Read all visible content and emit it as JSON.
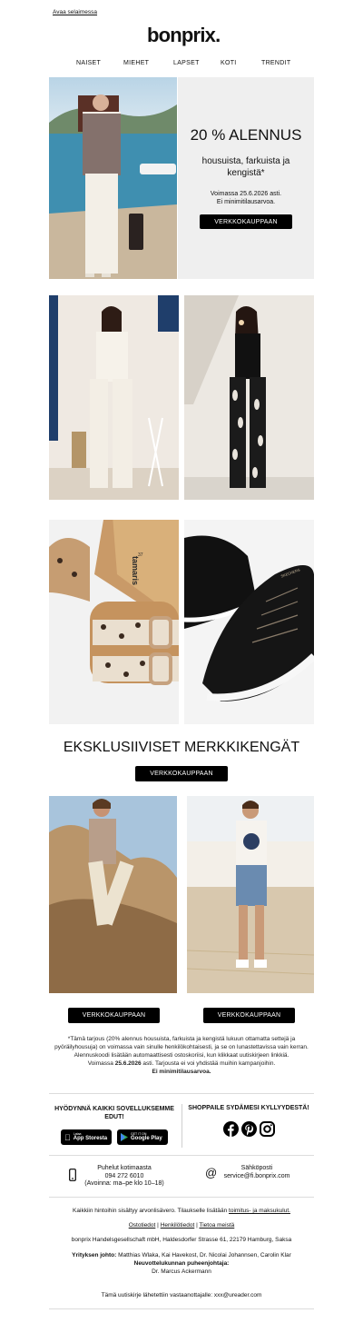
{
  "topbar": {
    "open_in_browser": "Avaa selaimessa"
  },
  "brand": {
    "logo": "bonprix."
  },
  "nav": {
    "items": [
      "NAISET",
      "MIEHET",
      "LAPSET",
      "KOTI",
      "TRENDIT"
    ]
  },
  "hero": {
    "headline": "20 % ALENNUS",
    "subline": "housuista, farkuista ja kengistä*",
    "valid_line": "Voimassa 25.6.2026 asti.",
    "min_line": "Ei minimitilausarvoa.",
    "cta": "VERKKOKAUPPAAN"
  },
  "section_shoes": {
    "title": "EKSKLUSIIVISET MERKKIKENGÄT",
    "cta": "VERKKOKAUPPAAN"
  },
  "products": {
    "shoe_brand": "tamaris",
    "shoe_size": "37",
    "sneaker_brand": "SKECHERS"
  },
  "men_kids": {
    "cta_left": "VERKKOKAUPPAAN",
    "cta_right": "VERKKOKAUPPAAN"
  },
  "disclaimer": {
    "text1": "*Tämä tarjous (20% alennus housuista, farkuista ja kengistä lukuun ottamatta settejä ja pyöräilyhousuja) on voimassa vain sinulle henkilökohtaisesti, ja se on lunastettavissa vain kerran. Alennuskoodi lisätään automaattisesti ostoskoriisi, kun klikkaat uutiskirjeen linkkiä.",
    "valid_prefix": "Voimassa ",
    "valid_date": "25.6.2026",
    "valid_suffix": " asti. Tarjousta ei voi yhdistää muihin kampanjoihin.",
    "min": "Ei minimitilausarvoa."
  },
  "apps": {
    "title": "HYÖDYNNÄ KAIKKI SOVELLUKSEMME EDUT!",
    "appstore_small": "Lataa",
    "appstore": "App Storesta",
    "googleplay_small": "GET IT ON",
    "googleplay": "Google Play"
  },
  "social": {
    "title": "SHOPPAILE SYDÄMESI KYLLYYDESTÄ!"
  },
  "contact": {
    "phone_title": "Puhelut kotimaasta",
    "phone_number": "094 272 6010",
    "phone_hours": "(Avoinna: ma–pe klo 10–18)",
    "email_title": "Sähköposti",
    "email": "service@fi.bonprix.com"
  },
  "footer": {
    "rights_prefix": "Kaikkiin hintoihin sisältyy arvonlisävero. Tilaukselle lisätään ",
    "rights_link": "toimitus- ja maksukulut.",
    "link1": "Ostotiedot",
    "link2": "Henkilötiedot",
    "link3": "Tietoa meistä",
    "sep": "|",
    "address": "bonprix Handelsgesellschaft mbH, Haldesdorfer Strasse 61, 22179 Hamburg, Saksa",
    "mgmt_label": "Yrityksen johto:",
    "mgmt_names": " Matthias Wlaka, Kai Havekost, Dr. Nicolai Johannsen, Carolin Klar",
    "board_label": "Neuvottelukunnan puheenjohtaja:",
    "board_name": "Dr. Marcus Ackermann",
    "recipient": "Tämä uutiskirje lähetettiin vastaanottajalle: xxx@ureader.com"
  },
  "colors": {
    "accent": "#000000",
    "panel": "#efefef",
    "background": "#ffffff"
  }
}
